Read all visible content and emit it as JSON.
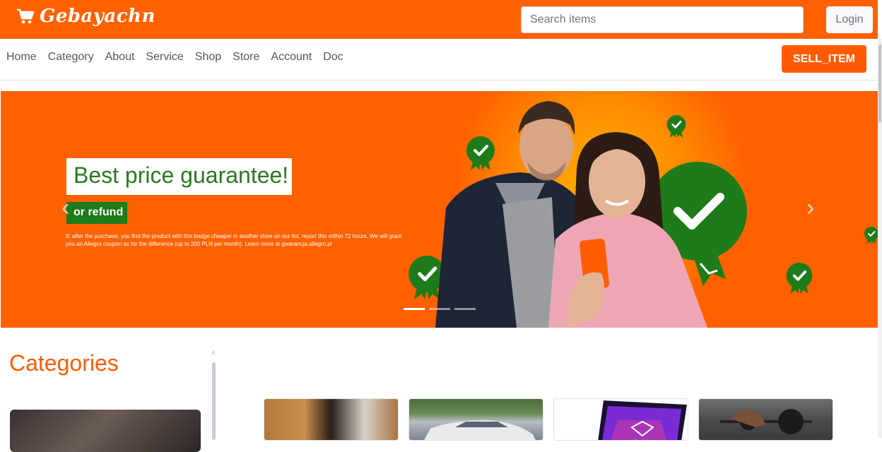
{
  "header": {
    "brand": "Gebayachn",
    "search_placeholder": "Search items",
    "login_label": "Login"
  },
  "nav": {
    "links": [
      "Home",
      "Category",
      "About",
      "Service",
      "Shop",
      "Store",
      "Account",
      "Doc"
    ],
    "sell_label": "SELL_ITEM"
  },
  "banner": {
    "headline": "Best price guarantee!",
    "subhead": "or refund",
    "fine_print": "If, after the purchase, you find the product with this badge cheaper in another store on our list, report this within 72 hours. We will grant you an Allegro coupon as for the difference (up to 200 PLN per month). Learn more at gwarancja.allegro.pl",
    "prev_icon": "‹",
    "next_icon": "›",
    "slides": 3,
    "active_slide": 1
  },
  "main": {
    "categories_title": "Categories"
  },
  "colors": {
    "brand": "#ff6100",
    "sell_button": "#ff5a00",
    "headline_text": "#2a7a1e",
    "badge_green": "#1e7b19"
  }
}
